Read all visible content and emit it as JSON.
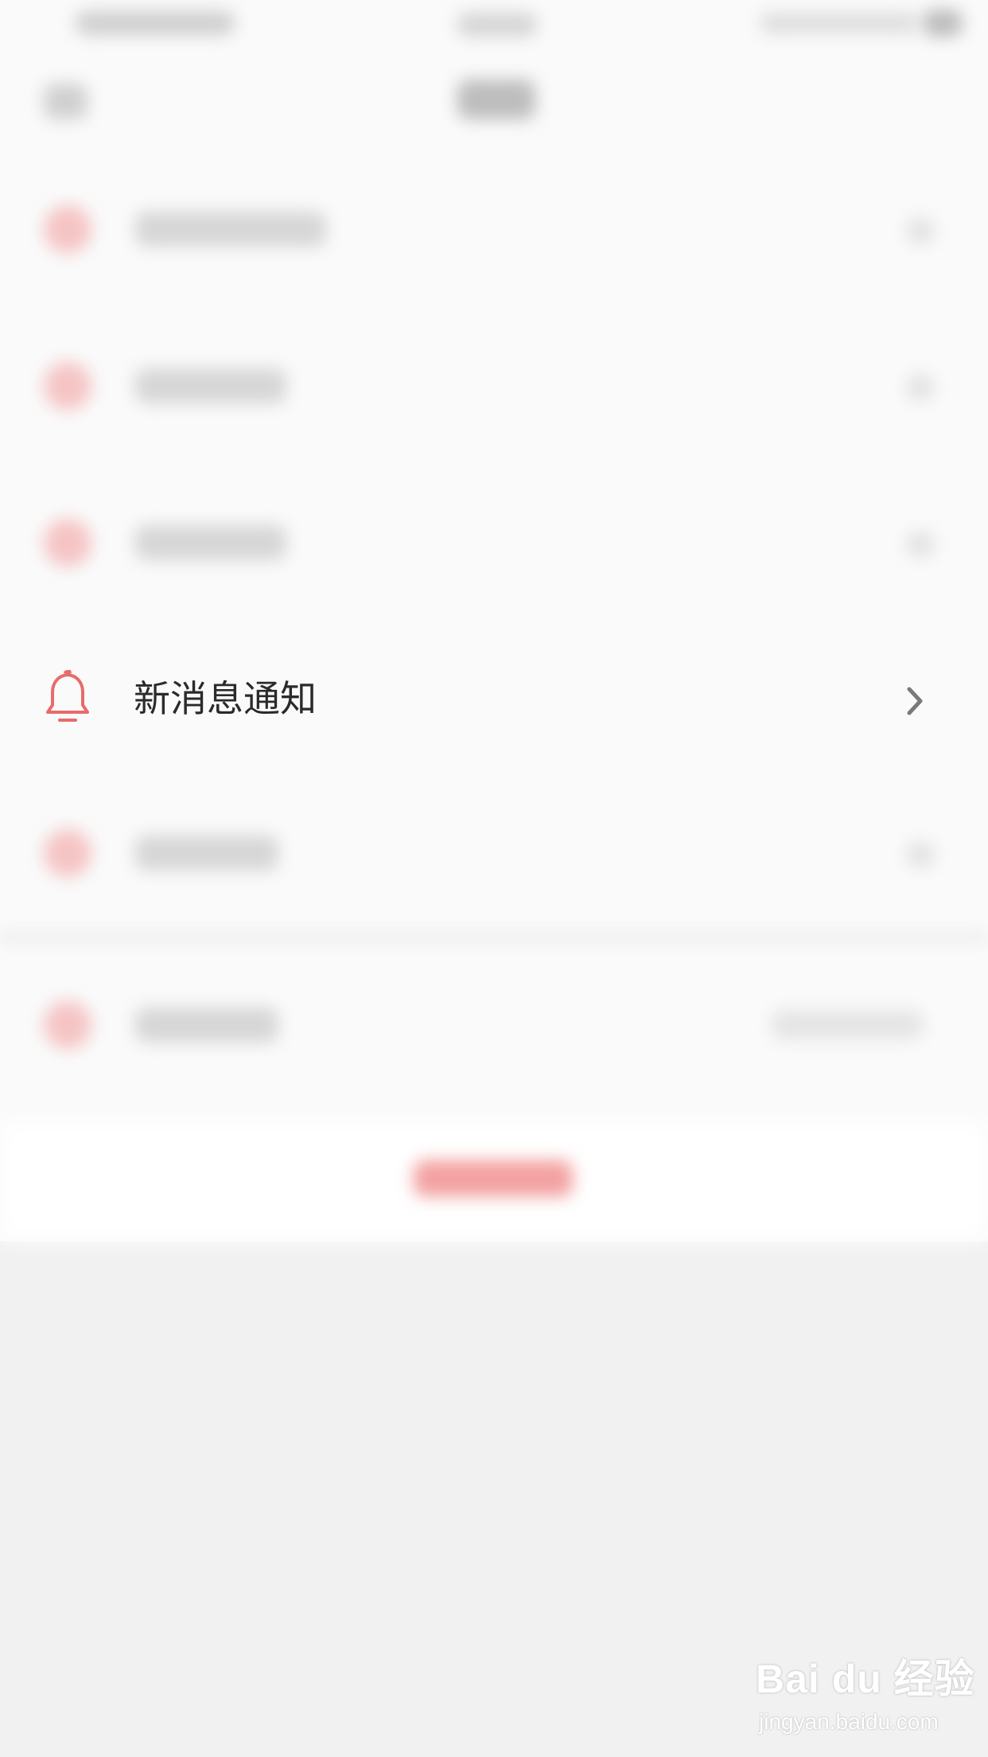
{
  "settings_list": {
    "highlighted_item": {
      "label": "新消息通知",
      "icon": "bell-icon",
      "accent_color": "#e86b6b"
    }
  },
  "watermark": {
    "brand": "Bai du 经验",
    "site": "jingyan.baidu.com"
  },
  "colors": {
    "background": "#f1f1f1",
    "list_background": "#fafafa",
    "text": "#2a2a2a",
    "chevron": "#7a7a7a"
  }
}
